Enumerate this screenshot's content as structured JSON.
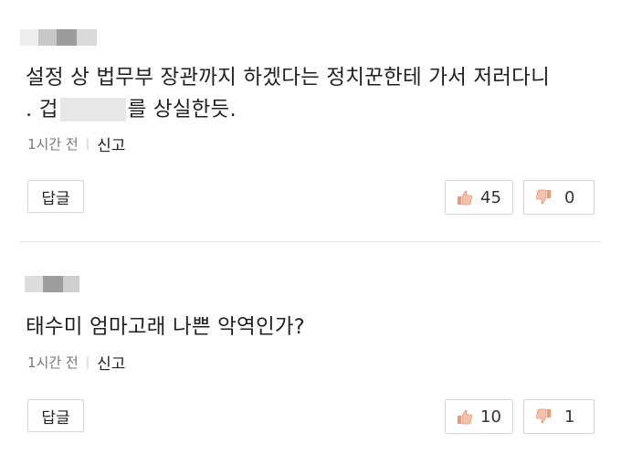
{
  "comments": [
    {
      "author_mosaic_colors": [
        "#e8e8e8",
        "#bdbdbd",
        "#8f8f8f",
        "#d6d6d6"
      ],
      "text_line1": "설정 상 법무부 장관까지 하겠다는 정치꾼한테 가서 저러다니",
      "text_line2_prefix": ". 겁",
      "text_line2_suffix": "를 상실한듯.",
      "time": "1시간 전",
      "report_label": "신고",
      "reply_label": "답글",
      "upvotes": "45",
      "downvotes": "0"
    },
    {
      "author_mosaic_colors": [
        "#d9d9d9",
        "#9a9a9a",
        "#c8c8c8"
      ],
      "text_line1": "태수미 엄마고래 나쁜 악역인가?",
      "time": "1시간 전",
      "report_label": "신고",
      "reply_label": "답글",
      "upvotes": "10",
      "downvotes": "1"
    }
  ],
  "colors": {
    "thumb_up": "#e69a7a",
    "thumb_down": "#e69a7a",
    "border": "#d6d6d6"
  },
  "icons": {
    "upvote": "thumbs-up-icon",
    "downvote": "thumbs-down-icon"
  }
}
